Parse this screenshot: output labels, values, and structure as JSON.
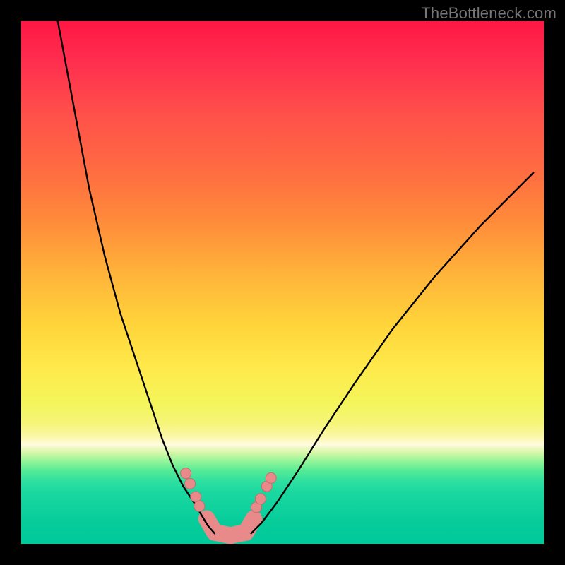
{
  "watermark": "TheBottleneck.com",
  "colors": {
    "bead": "#e88a89",
    "curve": "#000000"
  },
  "chart_data": {
    "type": "line",
    "title": "",
    "xlabel": "",
    "ylabel": "",
    "xlim": [
      0,
      100
    ],
    "ylim": [
      0,
      100
    ],
    "grid": false,
    "legend": false,
    "annotations": [
      "TheBottleneck.com"
    ],
    "series": [
      {
        "name": "left-curve",
        "x": [
          7,
          10,
          13,
          16,
          19,
          22,
          25,
          27,
          29,
          31,
          33,
          34.5,
          35.7,
          37
        ],
        "y": [
          100,
          84,
          68,
          55,
          44,
          35,
          26,
          20,
          15,
          11,
          8,
          5.5,
          3.5,
          2
        ]
      },
      {
        "name": "right-curve",
        "x": [
          44,
          46,
          49,
          53,
          58,
          64,
          71,
          79,
          88,
          98
        ],
        "y": [
          2,
          4,
          8,
          14,
          22,
          31,
          41,
          51,
          61,
          71
        ]
      }
    ],
    "markers": {
      "name": "beads",
      "note": "small salmon circles near the valley on both curves",
      "points": [
        {
          "x": 31.5,
          "y": 13.5
        },
        {
          "x": 32.3,
          "y": 11.5
        },
        {
          "x": 33.4,
          "y": 9.0
        },
        {
          "x": 34.1,
          "y": 7.2
        },
        {
          "x": 45.0,
          "y": 7.0
        },
        {
          "x": 45.8,
          "y": 8.6
        },
        {
          "x": 47.0,
          "y": 11.0
        },
        {
          "x": 47.8,
          "y": 12.6
        }
      ]
    },
    "bottom_highlight": {
      "name": "valley-worm",
      "note": "thick salmon rounded segment tracing the valley floor",
      "points": [
        {
          "x": 35.5,
          "y": 4.8
        },
        {
          "x": 37.0,
          "y": 2.2
        },
        {
          "x": 40.0,
          "y": 1.6
        },
        {
          "x": 43.0,
          "y": 2.2
        },
        {
          "x": 44.5,
          "y": 4.8
        }
      ]
    }
  }
}
